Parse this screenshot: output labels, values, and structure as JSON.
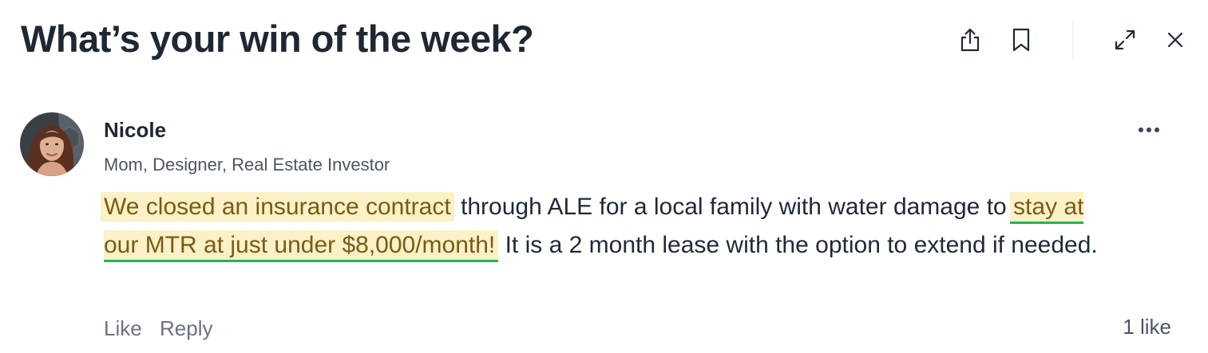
{
  "header": {
    "title": "What’s your win of the week?",
    "icons": {
      "share": "share-icon",
      "bookmark": "bookmark-icon",
      "expand": "expand-icon",
      "close": "close-icon"
    }
  },
  "comment": {
    "author": {
      "name": "Nicole",
      "bio": "Mom, Designer, Real Estate Investor",
      "avatar_icon": "avatar"
    },
    "more_icon": "more-horizontal-icon",
    "body": {
      "highlight_1": "We closed an insurance contract",
      "text_1": " through ALE for a local family with water damage to ",
      "highlight_2": "stay at our MTR at just under $8,000/month!",
      "text_2": " It is a 2 month lease with the option to extend if needed."
    },
    "actions": {
      "like_label": "Like",
      "reply_label": "Reply"
    },
    "likes_count_label": "1 like"
  },
  "colors": {
    "text": "#1e2733",
    "highlight_bg": "#fbf1c7",
    "highlight_text": "#7a5b14",
    "highlight_underline": "#22b455",
    "muted": "#6b7280"
  }
}
